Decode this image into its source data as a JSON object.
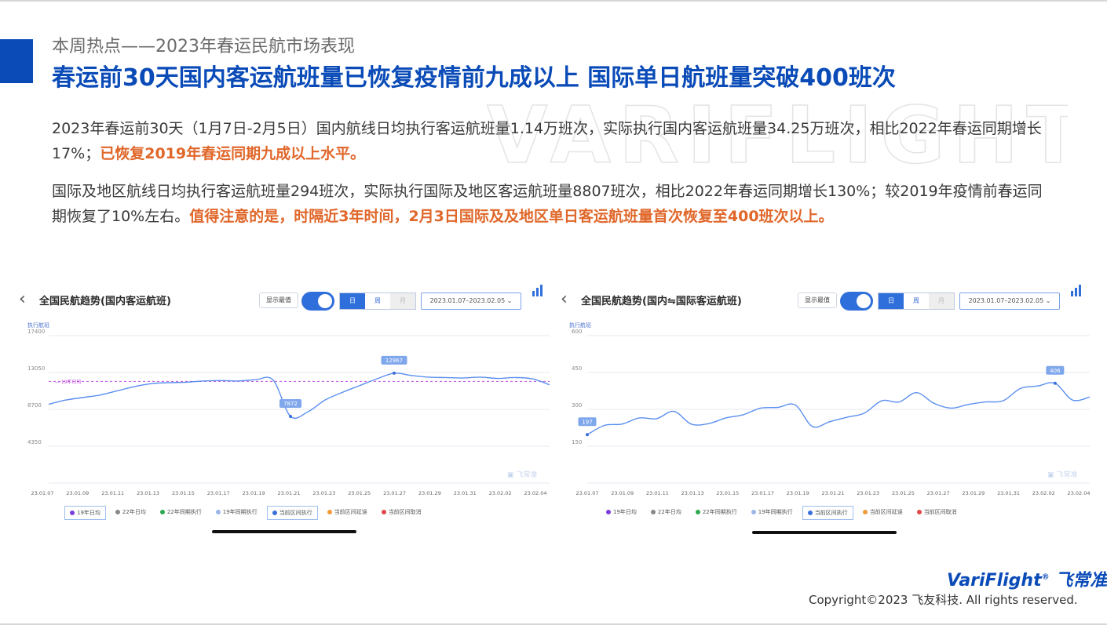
{
  "watermark": "VARIFLIGHT",
  "header": {
    "subtitle": "本周热点——2023年春运民航市场表现",
    "headline": "春运前30天国内客运航班量已恢复疫情前九成以上  国际单日航班量突破400班次"
  },
  "paragraphs": {
    "p1_normal": "2023年春运前30天（1月7日-2月5日）国内航线日均执行客运航班量1.14万班次，实际执行国内客运航班量34.25万班次，相比2022年春运同期增长17%；",
    "p1_highlight": "已恢复2019年春运同期九成以上水平。",
    "p2_normal": "国际及地区航线日均执行客运航班量294班次，实际执行国际及地区客运航班量8807班次，相比2022年春运同期增长130%；较2019年疫情前春运同期恢复了10%左右。",
    "p2_highlight": "值得注意的是，时隔近3年时间，2月3日国际及及地区单日客运航班量首次恢复至400班次以上。"
  },
  "colors": {
    "brand": "#0a4bb8",
    "highlight": "#e0672a",
    "series": "#5b8ff0",
    "ref_line": "#c04ce0"
  },
  "charts": {
    "left": {
      "title": "全国民航趋势(国内客运航班)",
      "show_label": "显示最值",
      "seg": [
        "日",
        "周",
        "月"
      ],
      "date_range": "2023.01.07–2023.02.05 ⌄",
      "y_title": "执行航班",
      "ref_label": "19年日均",
      "brand_mark": "飞常准",
      "legend": [
        "19年日均",
        "22年日均",
        "22年同期执行",
        "19年同期执行",
        "当前区间执行",
        "当前区间延误",
        "当前区间取消"
      ]
    },
    "right": {
      "title": "全国民航趋势(国内⇋国际客运航班)",
      "show_label": "显示最值",
      "seg": [
        "日",
        "周",
        "月"
      ],
      "date_range": "2023.01.07–2023.02.05 ⌄",
      "y_title": "执行航班",
      "brand_mark": "飞常准",
      "legend": [
        "19年日均",
        "22年日均",
        "22年同期执行",
        "19年同期执行",
        "当前区间执行",
        "当前区间延误",
        "当前区间取消"
      ]
    }
  },
  "chart_data": [
    {
      "type": "line",
      "title": "全国民航趋势(国内客运航班)",
      "ylabel": "执行航班",
      "ylim": [
        0,
        17400
      ],
      "yticks": [
        4350,
        8700,
        13050,
        17400
      ],
      "ytick_labels": [
        "4350",
        "8700",
        "13050",
        "17400"
      ],
      "xtick_labels": [
        "23.01.07",
        "23.01.09",
        "23.01.11",
        "23.01.13",
        "23.01.15",
        "23.01.17",
        "23.01.19",
        "23.01.21",
        "23.01.23",
        "23.01.25",
        "23.01.27",
        "23.01.29",
        "23.01.31",
        "23.02.02",
        "23.02.04"
      ],
      "reference_line": {
        "name": "19年日均",
        "value": 12000
      },
      "annotations": [
        {
          "index": 14,
          "label": "7872"
        },
        {
          "index": 20,
          "label": "12967"
        }
      ],
      "series": [
        {
          "name": "当前区间执行",
          "values": [
            9300,
            9800,
            10100,
            10400,
            10900,
            11400,
            11750,
            11850,
            11900,
            12050,
            12100,
            12050,
            12200,
            12150,
            7872,
            8400,
            9800,
            10700,
            11500,
            12300,
            12967,
            12700,
            12500,
            12450,
            12400,
            12500,
            12350,
            12450,
            12300,
            11600
          ]
        }
      ]
    },
    {
      "type": "line",
      "title": "全国民航趋势(国内⇋国际客运航班)",
      "ylabel": "执行航班",
      "ylim": [
        0,
        600
      ],
      "yticks": [
        150,
        300,
        450,
        600
      ],
      "ytick_labels": [
        "150",
        "300",
        "450",
        "600"
      ],
      "xtick_labels": [
        "23.01.07",
        "23.01.09",
        "23.01.11",
        "23.01.13",
        "23.01.15",
        "23.01.17",
        "23.01.19",
        "23.01.21",
        "23.01.23",
        "23.01.25",
        "23.01.27",
        "23.01.29",
        "23.01.31",
        "23.02.02",
        "23.02.04"
      ],
      "annotations": [
        {
          "index": 0,
          "label": "197"
        },
        {
          "index": 27,
          "label": "406"
        }
      ],
      "series": [
        {
          "name": "当前区间执行",
          "values": [
            197,
            235,
            240,
            265,
            262,
            292,
            240,
            242,
            265,
            278,
            305,
            308,
            318,
            230,
            250,
            268,
            285,
            335,
            330,
            368,
            325,
            305,
            320,
            330,
            335,
            385,
            395,
            406,
            338,
            350
          ]
        }
      ]
    }
  ],
  "footer": {
    "logo_en": "VariFlight",
    "logo_cn": "飞常准",
    "copyright": "Copyright©2023 飞友科技. All rights reserved."
  }
}
